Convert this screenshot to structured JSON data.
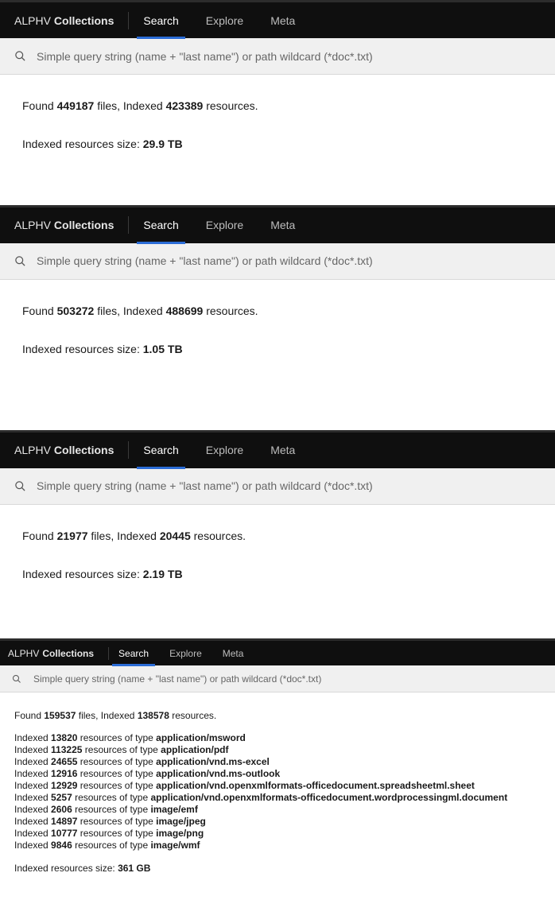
{
  "brand": {
    "prefix": "ALPHV",
    "suffix": "Collections"
  },
  "nav": {
    "search": "Search",
    "explore": "Explore",
    "meta": "Meta"
  },
  "search_placeholder": "Simple query string (name + \"last name\") or path wildcard (*doc*.txt)",
  "labels": {
    "found": "Found",
    "files_indexed": "files, Indexed",
    "resources": "resources.",
    "indexed_size": "Indexed resources size:",
    "indexed": "Indexed",
    "resources_of_type": "resources of type"
  },
  "panels": [
    {
      "files": "449187",
      "indexed": "423389",
      "size": "29.9 TB"
    },
    {
      "files": "503272",
      "indexed": "488699",
      "size": "1.05 TB"
    },
    {
      "files": "21977",
      "indexed": "20445",
      "size": "2.19 TB"
    },
    {
      "files": "159537",
      "indexed": "138578",
      "size": "361 GB"
    }
  ],
  "breakdown": [
    {
      "count": "13820",
      "type": "application/msword"
    },
    {
      "count": "113225",
      "type": "application/pdf"
    },
    {
      "count": "24655",
      "type": "application/vnd.ms-excel"
    },
    {
      "count": "12916",
      "type": "application/vnd.ms-outlook"
    },
    {
      "count": "12929",
      "type": "application/vnd.openxmlformats-officedocument.spreadsheetml.sheet"
    },
    {
      "count": "5257",
      "type": "application/vnd.openxmlformats-officedocument.wordprocessingml.document"
    },
    {
      "count": "2606",
      "type": "image/emf"
    },
    {
      "count": "14897",
      "type": "image/jpeg"
    },
    {
      "count": "10777",
      "type": "image/png"
    },
    {
      "count": "9846",
      "type": "image/wmf"
    }
  ]
}
